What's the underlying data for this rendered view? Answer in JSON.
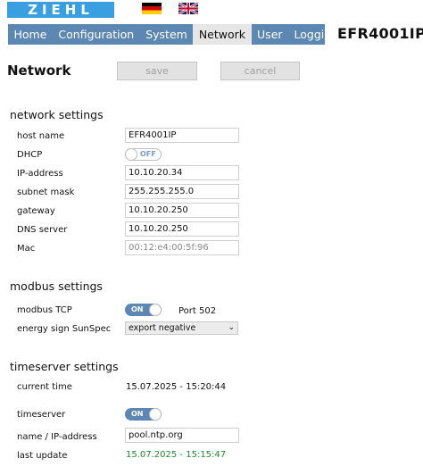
{
  "header": {
    "logo_text": "ZIEHL",
    "device_name": "EFR4001IP",
    "flags": [
      "german-flag-icon",
      "uk-flag-icon"
    ]
  },
  "nav": {
    "items": [
      "Home",
      "Configuration",
      "System",
      "Network",
      "User",
      "Logging"
    ],
    "active": "Network"
  },
  "page": {
    "title": "Network",
    "save_label": "save",
    "cancel_label": "cancel"
  },
  "network": {
    "title": "network settings",
    "host_name_label": "host name",
    "host_name": "EFR4001IP",
    "dhcp_label": "DHCP",
    "dhcp_state": "OFF",
    "ip_label": "IP-address",
    "ip": "10.10.20.34",
    "subnet_label": "subnet mask",
    "subnet": "255.255.255.0",
    "gateway_label": "gateway",
    "gateway": "10.10.20.250",
    "dns_label": "DNS server",
    "dns": "10.10.20.250",
    "mac_label": "Mac",
    "mac": "00:12:e4:00:5f:96"
  },
  "modbus": {
    "title": "modbus settings",
    "tcp_label": "modbus TCP",
    "tcp_state": "ON",
    "port_text": "Port 502",
    "sunspec_label": "energy sign SunSpec",
    "sunspec_value": "export negative"
  },
  "timeserver": {
    "title": "timeserver settings",
    "current_time_label": "current time",
    "current_time": "15.07.2025 - 15:20:44",
    "timeserver_label": "timeserver",
    "timeserver_state": "ON",
    "name_label": "name / IP-address",
    "name": "pool.ntp.org",
    "last_update_label": "last update",
    "last_update": "15.07.2025 - 15:15:47"
  },
  "colors": {
    "nav_bg": "#5c87b2",
    "logo_bg": "#3a9fe0",
    "last_update_color": "#1e8c2d"
  }
}
